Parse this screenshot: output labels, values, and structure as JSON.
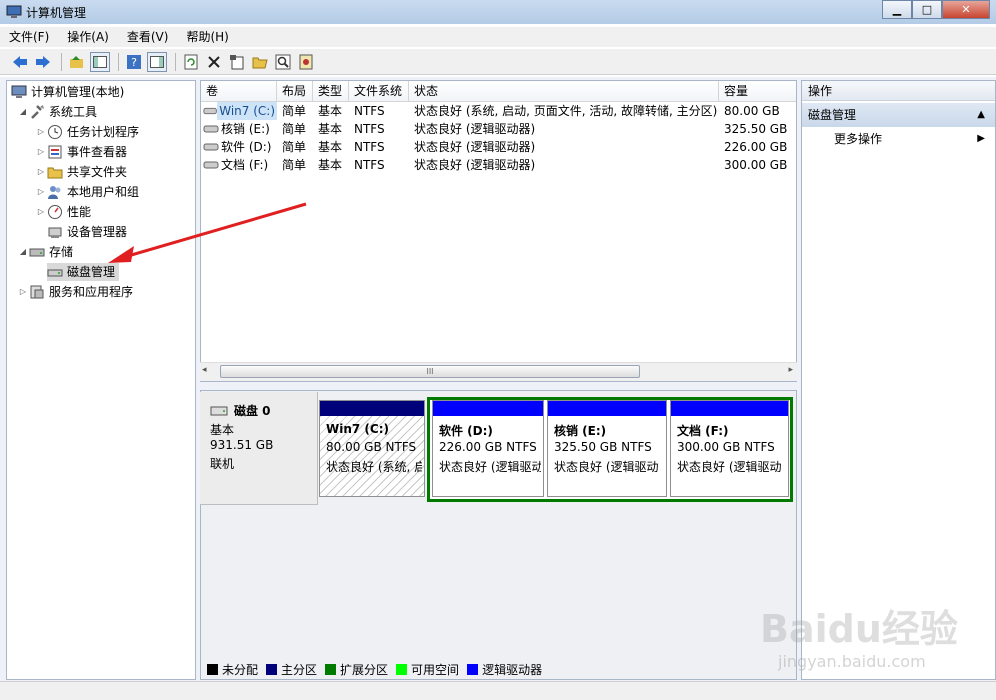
{
  "window": {
    "title": "计算机管理",
    "minimize": "▁",
    "maximize": "□",
    "close": "✕"
  },
  "menu": [
    "文件(F)",
    "操作(A)",
    "查看(V)",
    "帮助(H)"
  ],
  "toolbar_icons": [
    "back-arrow-icon",
    "forward-arrow-icon",
    "up-folder-icon",
    "show-hide-tree-icon",
    "help-icon",
    "properties-pane-icon",
    "refresh-icon",
    "delete-icon",
    "properties-icon",
    "open-folder-icon",
    "search-icon",
    "export-icon"
  ],
  "tree": [
    {
      "label": "计算机管理(本地)",
      "level": 0,
      "expander": "",
      "icon": "computer-icon"
    },
    {
      "label": "系统工具",
      "level": 1,
      "expander": "◢",
      "icon": "tools-icon"
    },
    {
      "label": "任务计划程序",
      "level": 2,
      "expander": "▷",
      "icon": "clock-icon"
    },
    {
      "label": "事件查看器",
      "level": 2,
      "expander": "▷",
      "icon": "event-viewer-icon"
    },
    {
      "label": "共享文件夹",
      "level": 2,
      "expander": "▷",
      "icon": "shared-folder-icon"
    },
    {
      "label": "本地用户和组",
      "level": 2,
      "expander": "▷",
      "icon": "users-icon"
    },
    {
      "label": "性能",
      "level": 2,
      "expander": "▷",
      "icon": "performance-icon"
    },
    {
      "label": "设备管理器",
      "level": 2,
      "expander": "",
      "icon": "device-manager-icon"
    },
    {
      "label": "存储",
      "level": 1,
      "expander": "◢",
      "icon": "storage-icon"
    },
    {
      "label": "磁盘管理",
      "level": 2,
      "expander": "",
      "icon": "disk-management-icon",
      "selected": true
    },
    {
      "label": "服务和应用程序",
      "level": 1,
      "expander": "▷",
      "icon": "services-icon"
    }
  ],
  "volume_table": {
    "headers": [
      "卷",
      "布局",
      "类型",
      "文件系统",
      "状态",
      "容量"
    ],
    "rows": [
      [
        "Win7 (C:)",
        "简单",
        "基本",
        "NTFS",
        "状态良好 (系统, 启动, 页面文件, 活动, 故障转储, 主分区)",
        "80.00 GB"
      ],
      [
        "核销 (E:)",
        "简单",
        "基本",
        "NTFS",
        "状态良好 (逻辑驱动器)",
        "325.50 GB"
      ],
      [
        "软件 (D:)",
        "简单",
        "基本",
        "NTFS",
        "状态良好 (逻辑驱动器)",
        "226.00 GB"
      ],
      [
        "文档 (F:)",
        "简单",
        "基本",
        "NTFS",
        "状态良好 (逻辑驱动器)",
        "300.00 GB"
      ]
    ]
  },
  "scroll_left": "◂",
  "scroll_right": "▸",
  "scroll_grip": "III",
  "disk": {
    "name": "磁盘 0",
    "type": "基本",
    "size": "931.51 GB",
    "status": "联机",
    "partitions": [
      {
        "title": "Win7  (C:)",
        "size": "80.00 GB NTFS",
        "status": "状态良好 (系统, 启",
        "bar": "#00007b"
      },
      {
        "title": "软件  (D:)",
        "size": "226.00 GB NTFS",
        "status": "状态良好 (逻辑驱动",
        "bar": "#0000ff"
      },
      {
        "title": "核销  (E:)",
        "size": "325.50 GB NTFS",
        "status": "状态良好 (逻辑驱动",
        "bar": "#0000ff"
      },
      {
        "title": "文档  (F:)",
        "size": "300.00 GB NTFS",
        "status": "状态良好 (逻辑驱动",
        "bar": "#0000ff"
      }
    ],
    "extended_color": "#007b00"
  },
  "legend": [
    {
      "label": "未分配",
      "color": "#000000"
    },
    {
      "label": "主分区",
      "color": "#00007b"
    },
    {
      "label": "扩展分区",
      "color": "#007b00"
    },
    {
      "label": "可用空间",
      "color": "#00ff00"
    },
    {
      "label": "逻辑驱动器",
      "color": "#0000ff"
    }
  ],
  "actions": {
    "header": "操作",
    "section": "磁盘管理",
    "more": "更多操作",
    "collapse": "▲",
    "expand": "▶"
  },
  "watermark": {
    "main": "Baidu经验",
    "sub": "jingyan.baidu.com"
  }
}
